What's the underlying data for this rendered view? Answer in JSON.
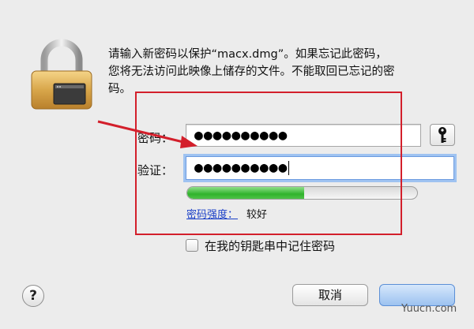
{
  "dialog": {
    "message_lines": [
      "请输入新密码以保护“macx.dmg”。如果忘记此密码，",
      "您将无法访问此映像上储存的文件。不能取回已忘记的密",
      "码。"
    ]
  },
  "form": {
    "password_label": "密码：",
    "password_value": "●●●●●●●●●●",
    "verify_label": "验证：",
    "verify_value": "●●●●●●●●●●"
  },
  "strength": {
    "link_label": "密码强度：",
    "value_label": "较好",
    "level_fraction": 0.51
  },
  "keychain": {
    "checkbox_label": "在我的钥匙串中记住密码",
    "checked": false
  },
  "buttons": {
    "help_label": "?",
    "cancel_label": "取消"
  },
  "watermark": {
    "text": "Yuucn.com"
  },
  "colors": {
    "annotation_red": "#d31f2b",
    "strength_green": "#30b32c",
    "focus_blue": "#9fc3f1",
    "link_blue": "#1a3fc7"
  },
  "icons": {
    "lock": "padlock-icon",
    "key": "key-icon",
    "arrow": "red-arrow-annotation"
  }
}
